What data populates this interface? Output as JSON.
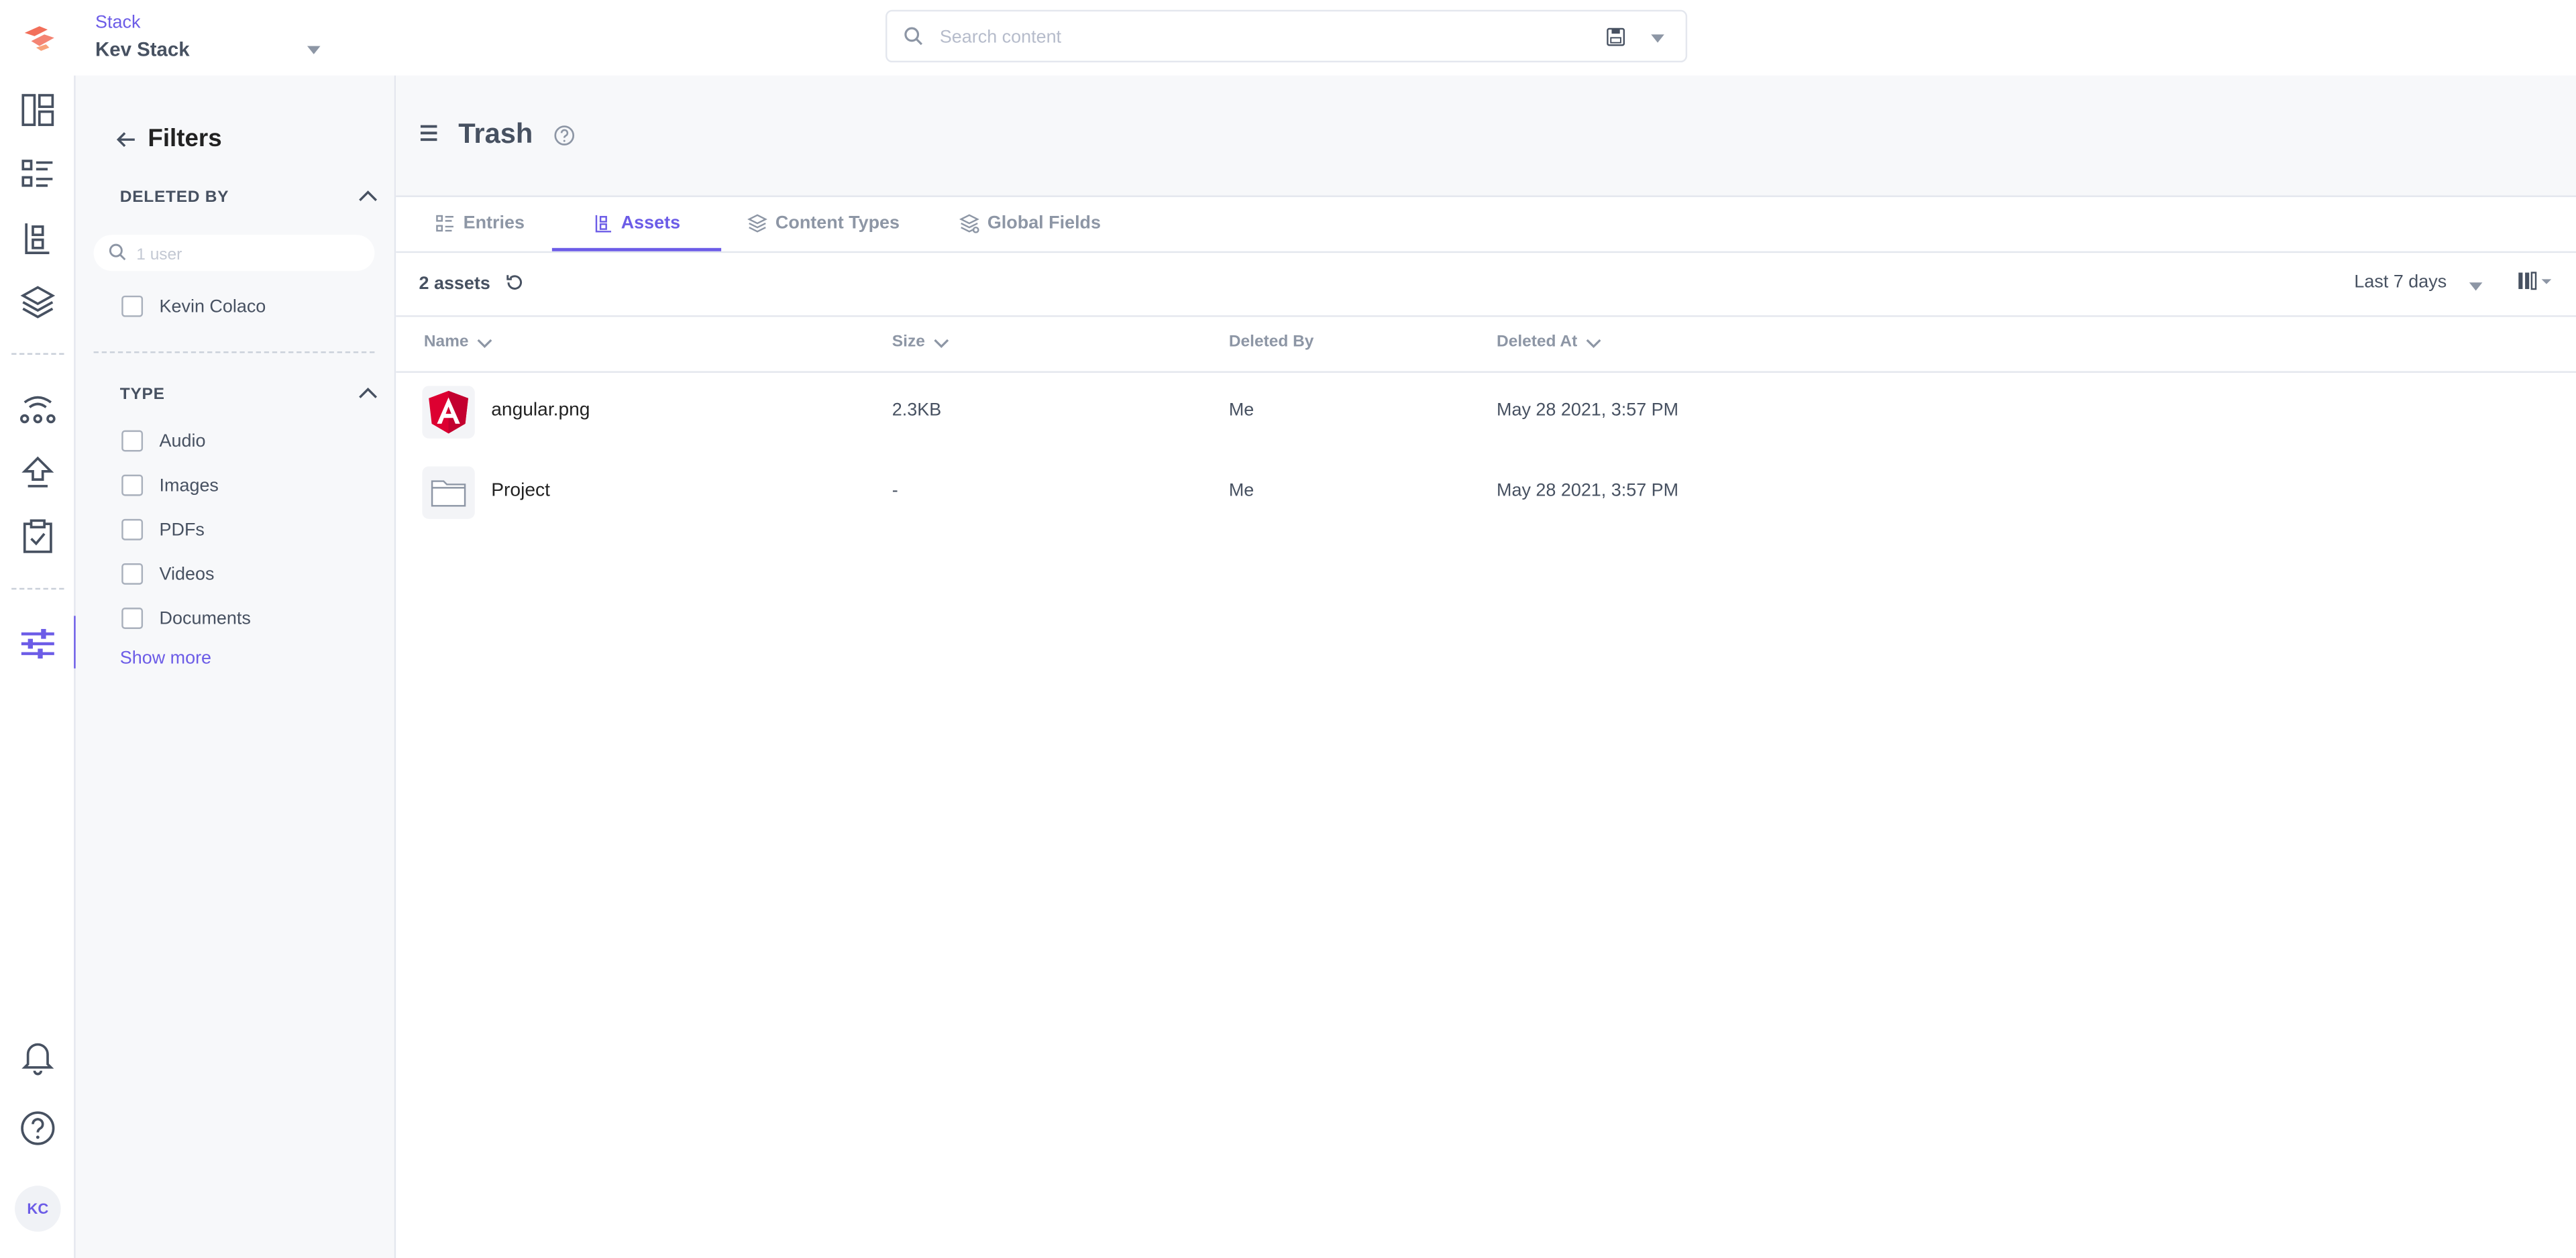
{
  "header": {
    "stack_label": "Stack",
    "stack_name": "Kev Stack",
    "search_placeholder": "Search content"
  },
  "rail": {
    "icons": [
      "dashboard-icon",
      "entries-icon",
      "assets-icon",
      "content-models-icon",
      "release-icon",
      "publish-icon",
      "tasks-icon",
      "settings-icon",
      "notifications-icon",
      "help-icon"
    ],
    "avatar_initials": "KC",
    "active": "settings-icon"
  },
  "filters": {
    "title": "Filters",
    "deleted_by": {
      "title": "DELETED BY",
      "search_placeholder": "1 user",
      "options": [
        "Kevin Colaco"
      ]
    },
    "type": {
      "title": "TYPE",
      "options": [
        "Audio",
        "Images",
        "PDFs",
        "Videos",
        "Documents"
      ]
    },
    "show_more": "Show more"
  },
  "page": {
    "title": "Trash",
    "tabs": [
      {
        "label": "Entries",
        "active": false
      },
      {
        "label": "Assets",
        "active": true
      },
      {
        "label": "Content Types",
        "active": false
      },
      {
        "label": "Global Fields",
        "active": false
      }
    ],
    "count_label": "2 assets",
    "range_label": "Last 7 days"
  },
  "table": {
    "columns": [
      "Name",
      "Size",
      "Deleted By",
      "Deleted At"
    ],
    "rows": [
      {
        "name": "angular.png",
        "size": "2.3KB",
        "deleted_by": "Me",
        "deleted_at": "May 28 2021, 3:57 PM",
        "kind": "image"
      },
      {
        "name": "Project",
        "size": "-",
        "deleted_by": "Me",
        "deleted_at": "May 28 2021, 3:57 PM",
        "kind": "folder"
      }
    ]
  },
  "colors": {
    "accent": "#6c5ce7",
    "logo": "#f26f5a",
    "angular_red": "#dd0031"
  }
}
